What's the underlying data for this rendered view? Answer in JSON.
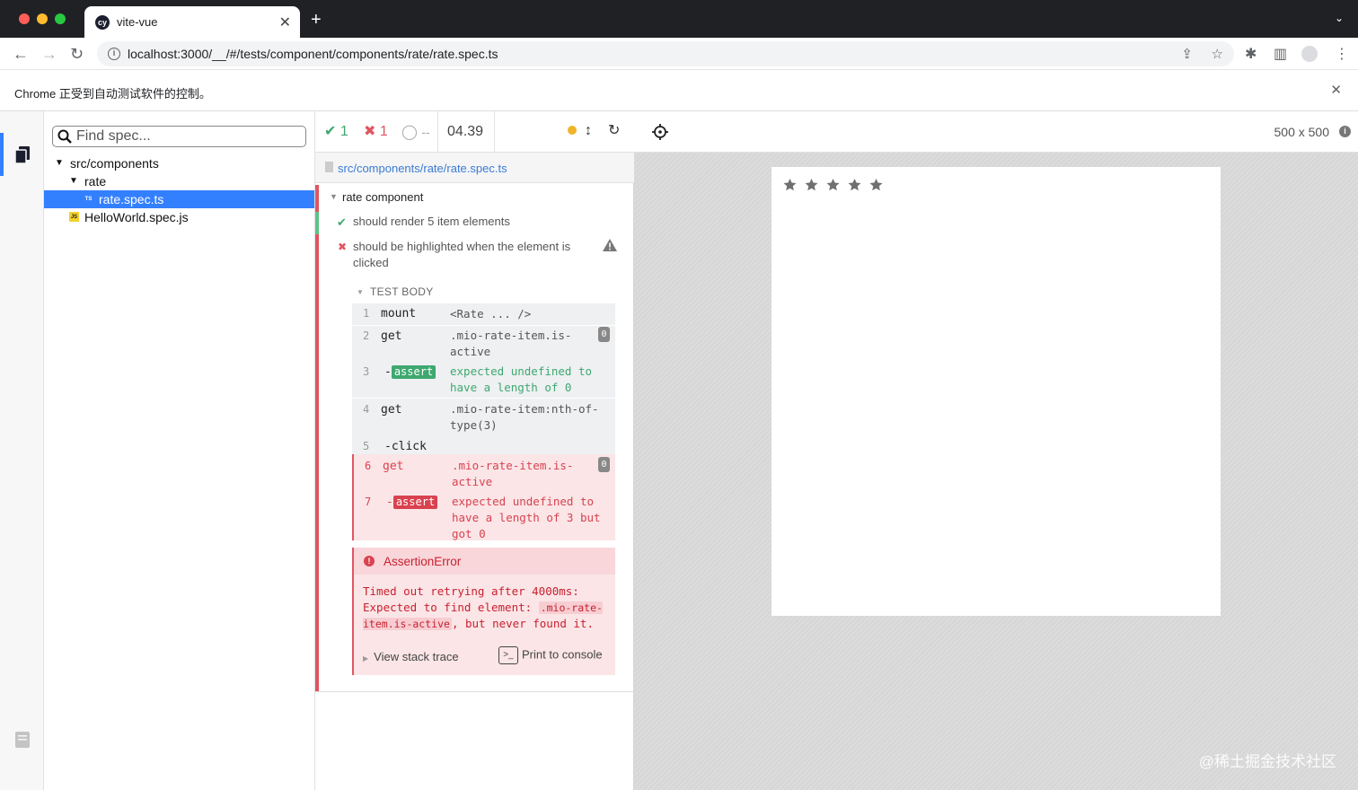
{
  "browser": {
    "tab_title": "vite-vue",
    "tab_favicon": "cy",
    "url": "localhost:3000/__/#/tests/component/components/rate/rate.spec.ts",
    "infobar_text": "Chrome 正受到自动测试软件的控制。"
  },
  "specs": {
    "search_placeholder": "Find spec...",
    "tree": {
      "folder": "src/components",
      "subfolder": "rate",
      "active_file": "rate.spec.ts",
      "active_file_badge": "TS",
      "other_file": "HelloWorld.spec.js",
      "other_file_badge": "JS"
    }
  },
  "reporter": {
    "passed": "1",
    "failed": "1",
    "pending": "--",
    "duration": "04.39",
    "spec_path": "src/components/rate/rate.spec.ts",
    "suite_title": "rate component",
    "tests": [
      {
        "title": "should render 5 item elements",
        "state": "passed"
      },
      {
        "title": "should be highlighted when the element is clicked",
        "state": "failed"
      }
    ],
    "test_body_label": "TEST BODY",
    "commands": [
      {
        "num": "1",
        "name": "mount",
        "message": "<Rate ... />"
      },
      {
        "num": "2",
        "name": "get",
        "message": ".mio-rate-item.is-active",
        "count": "0"
      },
      {
        "num": "3",
        "name": "-",
        "badge": "assert",
        "message": "expected undefined to have a length of 0"
      },
      {
        "num": "4",
        "name": "get",
        "message": ".mio-rate-item:nth-of-type(3)"
      },
      {
        "num": "5",
        "name": "-click",
        "message": ""
      },
      {
        "num": "6",
        "name": "get",
        "message": ".mio-rate-item.is-active",
        "count": "0"
      },
      {
        "num": "7",
        "name": "-",
        "badge": "assert",
        "message": "expected undefined to have a length of 3 but got 0"
      }
    ],
    "error": {
      "name": "AssertionError",
      "line1": "Timed out retrying after 4000ms:",
      "line2_prefix": "Expected to find element:",
      "selector": ".mio-rate-item.is-active",
      "line2_suffix": ", but never found it.",
      "stack_trace_label": "View stack trace",
      "print_label": "Print to console"
    }
  },
  "aut": {
    "viewport": "500 x 500",
    "stars_count": 5,
    "watermark": "@稀土掘金技术社区"
  },
  "colors": {
    "passed": "#3ea86f",
    "failed": "#e05561",
    "accent": "#3380ff",
    "pending_dot": "#f0b429"
  }
}
